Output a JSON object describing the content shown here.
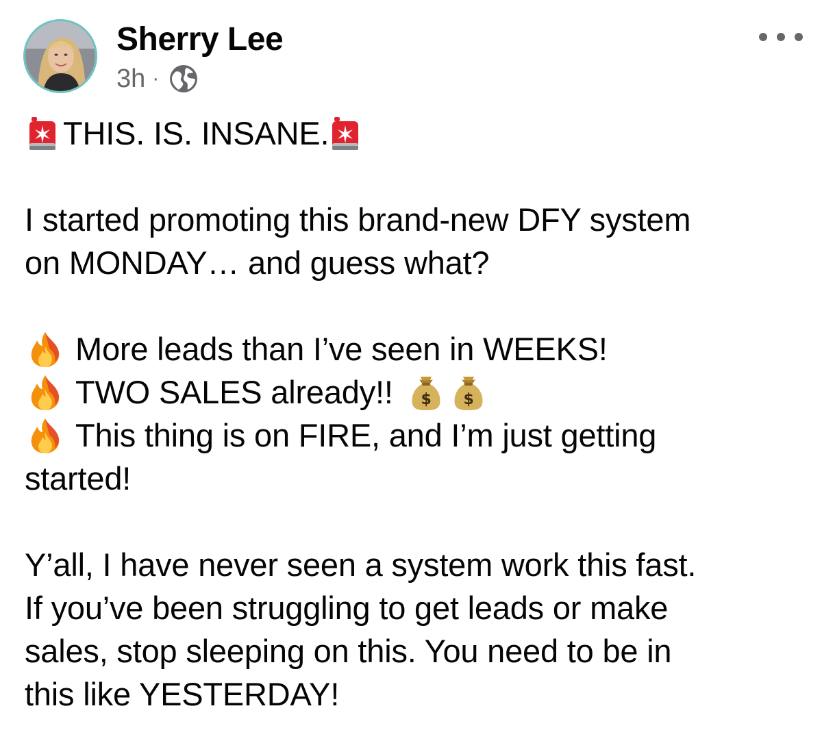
{
  "post": {
    "author": "Sherry Lee",
    "time": "3h",
    "separator": "·",
    "audience_icon": "globe-icon",
    "more_icon": "more-options-icon",
    "headline": {
      "left_icon": "siren-emoji",
      "text": "THIS. IS. INSANE.",
      "right_icon": "siren-emoji"
    },
    "paragraph1": [
      "I started promoting this brand-new DFY system",
      "on MONDAY… and guess what?"
    ],
    "bullets": [
      {
        "icon": "fire-emoji",
        "text": "More leads than I’ve seen in WEEKS!"
      },
      {
        "icon": "fire-emoji",
        "text": "TWO SALES already!!",
        "trailing_icons": [
          "money-bag-emoji",
          "money-bag-emoji"
        ]
      },
      {
        "icon": "fire-emoji",
        "text": "This thing is on FIRE, and I’m just getting",
        "continuation": "started!"
      }
    ],
    "paragraph2": [
      "Y’all, I have never seen a system work this fast.",
      "If you’ve been struggling to get leads or make",
      "sales, stop sleeping on this. You need to be in",
      "this like YESTERDAY!"
    ]
  },
  "colors": {
    "text": "#050505",
    "meta": "#65676b",
    "avatar_ring": "#6ec3c0",
    "siren_red": "#e0242f",
    "fire_orange": "#f4900c",
    "money_gold": "#c49a3c"
  }
}
